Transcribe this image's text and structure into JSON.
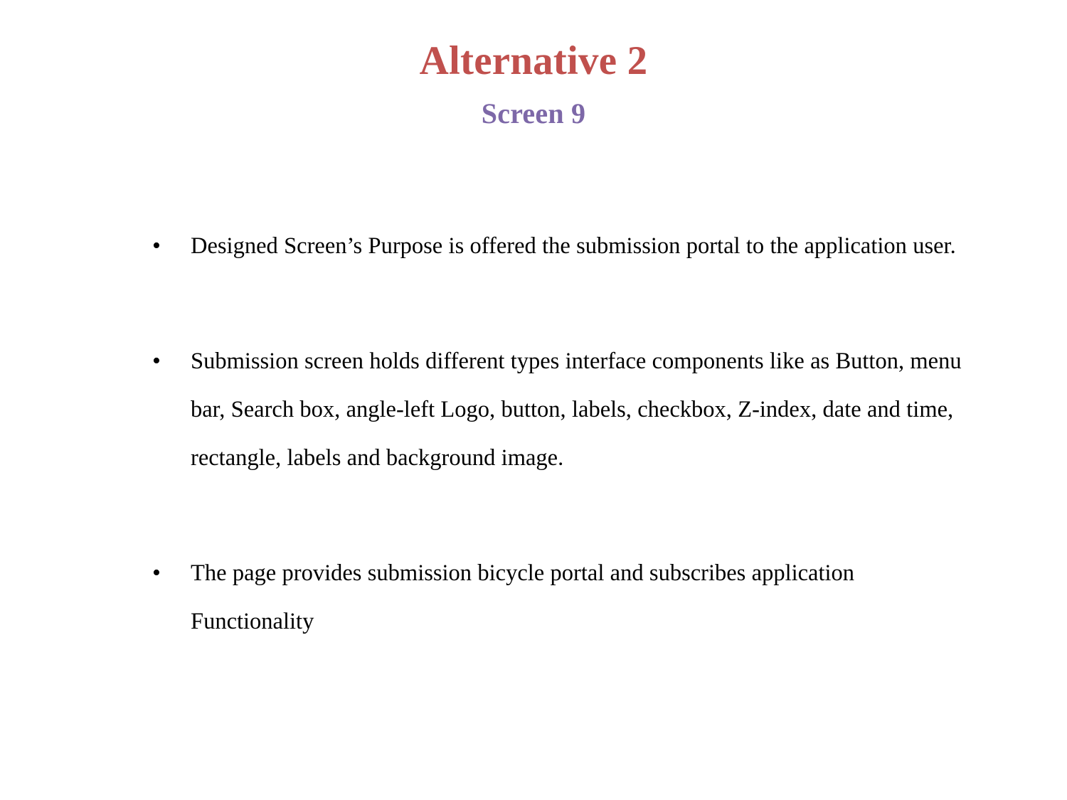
{
  "slide": {
    "title": "Alternative 2",
    "subtitle": "Screen 9",
    "title_color": "#C0504D",
    "subtitle_color": "#7D68A8",
    "text_color": "#000000",
    "background_color": "#FFFFFF",
    "bullet_glyph": "•"
  },
  "bullets": [
    {
      "marker": "•",
      "text": "Designed Screen’s Purpose is offered the submission portal to the application user."
    },
    {
      "marker": "•",
      "text": "Submission screen holds different types interface components like as Button, menu bar, Search box, angle-left Logo, button, labels, checkbox, Z-index, date and time, rectangle, labels and background image."
    },
    {
      "marker": "•",
      "text": "The page provides submission bicycle portal and subscribes application  Functionality"
    }
  ]
}
